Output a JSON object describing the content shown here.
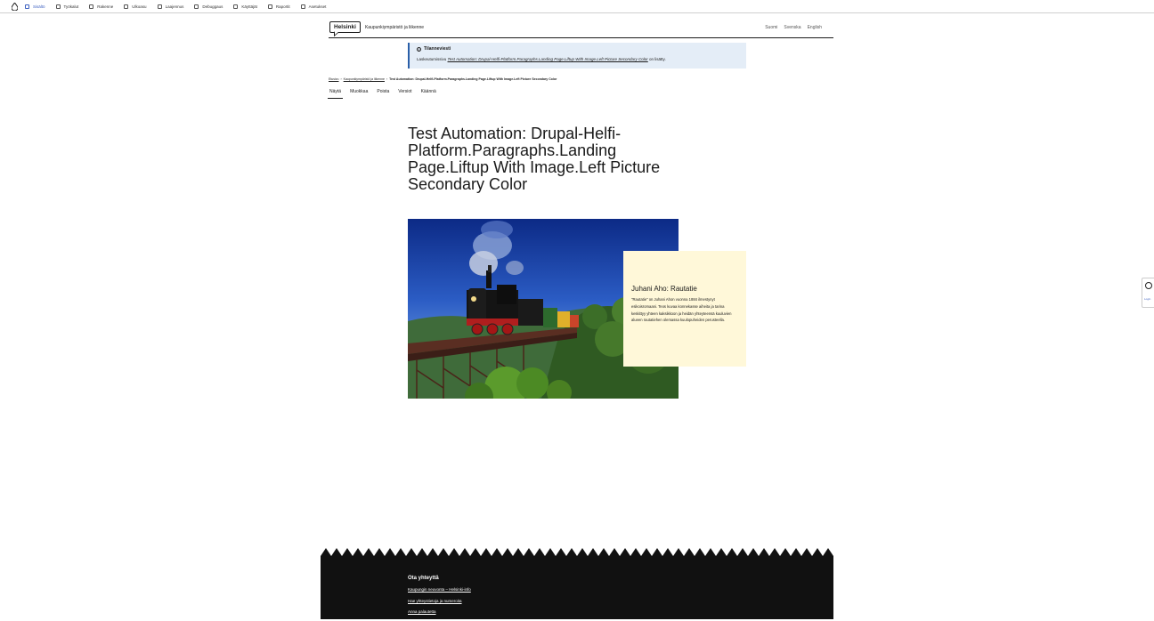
{
  "toolbar": {
    "items": [
      {
        "label": "Sisältö",
        "icon": "content-icon",
        "active": true
      },
      {
        "label": "Työkalut",
        "icon": "tools-icon"
      },
      {
        "label": "Rakenne",
        "icon": "structure-icon"
      },
      {
        "label": "Ulkoasu",
        "icon": "appearance-icon"
      },
      {
        "label": "Laajennus",
        "icon": "extend-icon"
      },
      {
        "label": "Debuggaus",
        "icon": "debug-icon"
      },
      {
        "label": "Käyttäjät",
        "icon": "users-icon"
      },
      {
        "label": "Raportit",
        "icon": "reports-icon"
      },
      {
        "label": "Asetukset",
        "icon": "settings-icon"
      }
    ]
  },
  "header": {
    "logo": "Helsinki",
    "site_name": "Kaupunkiympäristö ja liikenne",
    "languages": [
      {
        "label": "Suomi",
        "active": true
      },
      {
        "label": "Svenska"
      },
      {
        "label": "English"
      }
    ]
  },
  "status": {
    "title": "Tilanneviesti",
    "text_before": "Laskeutumissivu ",
    "link": "Test Automation: Drupal-Helfi-Platform.Paragraphs.Landing Page.Liftup With Image.Left Picture Secondary Color",
    "text_after": " on lisätty."
  },
  "breadcrumb": {
    "items": [
      "Etusivu",
      "Kaupunkiympäristö ja liikenne"
    ],
    "current": "Test Automation: Drupal-Helfi-Platform.Paragraphs.Landing Page.Liftup With Image.Left Picture Secondary Color",
    "separator": "›"
  },
  "tabs": [
    {
      "label": "Näytä",
      "active": true
    },
    {
      "label": "Muokkaa"
    },
    {
      "label": "Poista"
    },
    {
      "label": "Versiot"
    },
    {
      "label": "Käännä"
    }
  ],
  "page_title": "Test Automation: Drupal-Helfi-Platform.Paragraphs.Landing Page.Liftup With Image.Left Picture Secondary Color",
  "liftup": {
    "title": "Juhani Aho: Rautatie",
    "text": "\"Rautatie\" on Juhani Ahon vuonna 1884 ilmestynyt esikoisromaani. Teos kuvaa konnekasse aiheita ja tarina keskittyy yhteen kaksikkoon ja heidän yhteyteensä kuuluvien alueen rautatiehen olemassa kuulopuheiden perusteella."
  },
  "side_widget": {
    "label": "Login"
  },
  "footer": {
    "heading": "Ota yhteyttä",
    "links": [
      "Kaupungin neuvonta – Helsinki-info",
      "Hae yhteystietoja ja numeroita",
      "Anna palautetta"
    ]
  },
  "colors": {
    "accent": "#3b5fc0",
    "status_bg": "#e4edf7",
    "status_border": "#2a5fa8",
    "liftup_bg": "#fff8d9",
    "footer_bg": "#111111"
  }
}
